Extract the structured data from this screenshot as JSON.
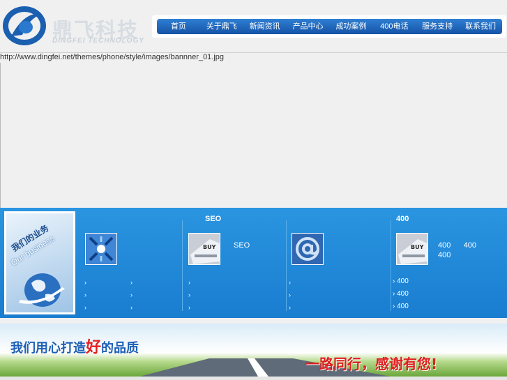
{
  "header": {
    "logo_text": "鼎飞科技",
    "logo_sub": "DINGFEI TECHNOLOGY"
  },
  "nav": {
    "items": [
      "首页",
      "关于鼎飞",
      "新闻资讯",
      "产品中心",
      "成功案例",
      "400电话",
      "服务支持",
      "联系我们"
    ]
  },
  "banner": {
    "alt_text": "http://www.dingfei.net/themes/phone/style/images/bannner_01.jpg"
  },
  "business": {
    "title": "我们的业务",
    "subtitle": "Our business",
    "columns": [
      {
        "title": "",
        "icon": "network-arrows-icon",
        "desc": "",
        "bullets": [
          "›",
          "›",
          "›",
          "›",
          "›",
          "›"
        ]
      },
      {
        "title": "SEO",
        "icon": "buy-keyboard-icon",
        "desc": "SEO",
        "bullets": [
          "›",
          "›",
          "›"
        ]
      },
      {
        "title": "",
        "icon": "email-at-icon",
        "desc": "",
        "bullets": [
          "›",
          "›",
          "›"
        ]
      },
      {
        "title": "400",
        "icon": "buy-keyboard-icon",
        "desc_line1": "400      400",
        "desc_line2": "400",
        "bullets": [
          "› 400",
          "› 400",
          "› 400"
        ]
      }
    ]
  },
  "slogan": {
    "left_a": "我们用心打造",
    "left_good": "好",
    "left_b": "的品质",
    "right": "一路同行，感谢有您!"
  },
  "colors": {
    "nav_blue": "#1553a6",
    "business_blue": "#1a7dd0",
    "slogan_blue": "#1d5fb5",
    "slogan_red": "#e01e1e"
  }
}
